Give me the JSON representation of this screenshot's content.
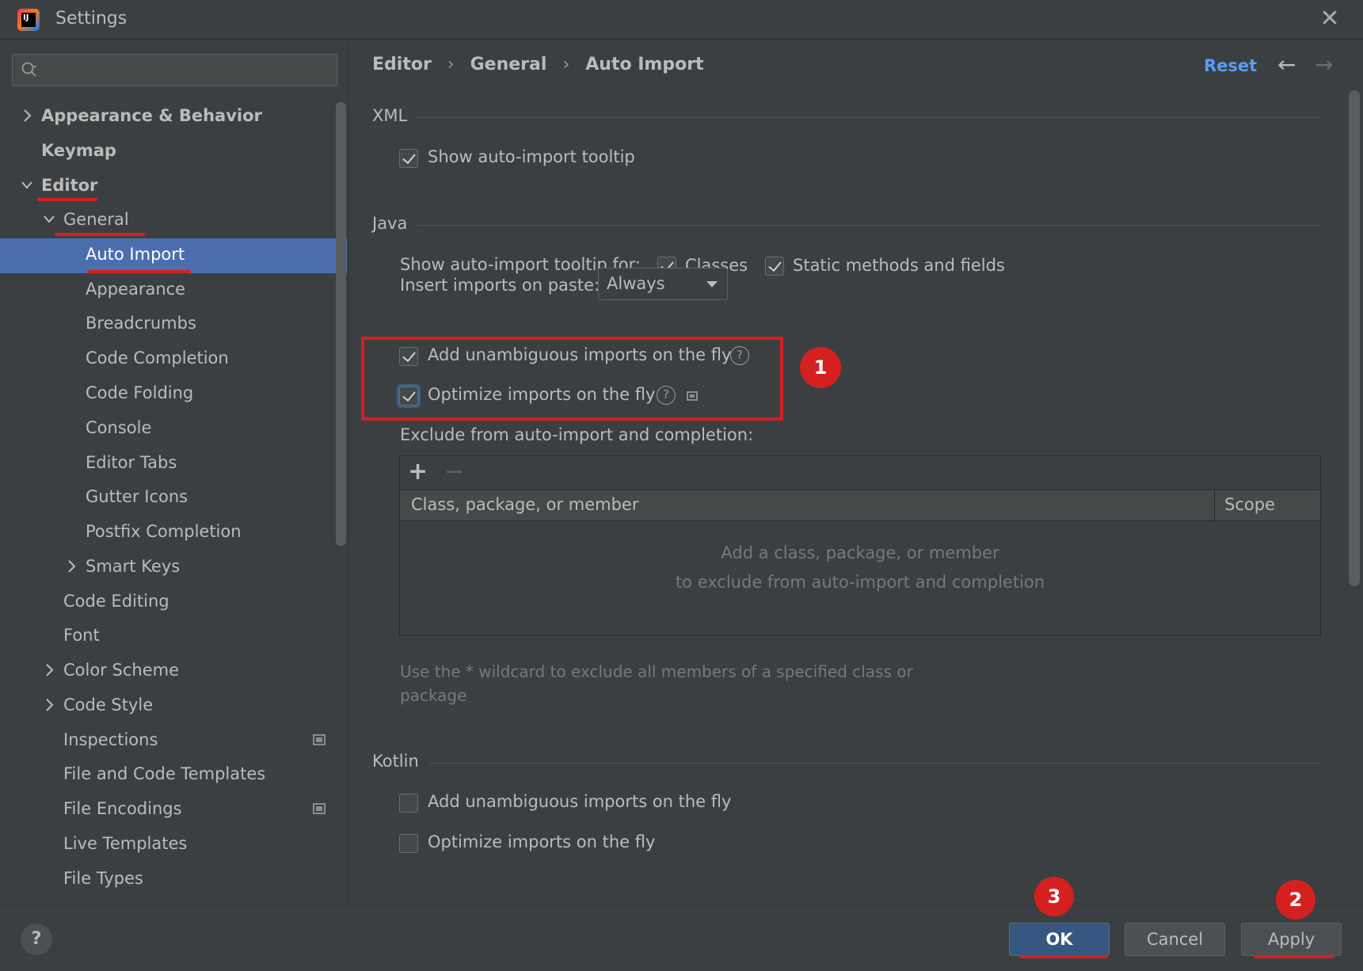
{
  "window": {
    "title": "Settings",
    "logo_text": "IJ"
  },
  "sidebar": {
    "search": {
      "placeholder": ""
    },
    "items": [
      {
        "label": "Appearance & Behavior",
        "arrow": "right"
      },
      {
        "label": "Keymap",
        "arrow": "none"
      },
      {
        "label": "Editor",
        "arrow": "down"
      },
      {
        "label": "General",
        "arrow": "down"
      },
      {
        "label": "Auto Import",
        "arrow": "none",
        "selected": true
      },
      {
        "label": "Appearance",
        "arrow": "none"
      },
      {
        "label": "Breadcrumbs",
        "arrow": "none"
      },
      {
        "label": "Code Completion",
        "arrow": "none"
      },
      {
        "label": "Code Folding",
        "arrow": "none"
      },
      {
        "label": "Console",
        "arrow": "none"
      },
      {
        "label": "Editor Tabs",
        "arrow": "none"
      },
      {
        "label": "Gutter Icons",
        "arrow": "none"
      },
      {
        "label": "Postfix Completion",
        "arrow": "none"
      },
      {
        "label": "Smart Keys",
        "arrow": "right"
      },
      {
        "label": "Code Editing",
        "arrow": "none"
      },
      {
        "label": "Font",
        "arrow": "none"
      },
      {
        "label": "Color Scheme",
        "arrow": "right"
      },
      {
        "label": "Code Style",
        "arrow": "right"
      },
      {
        "label": "Inspections",
        "arrow": "none",
        "badge": "project-settings-icon"
      },
      {
        "label": "File and Code Templates",
        "arrow": "none"
      },
      {
        "label": "File Encodings",
        "arrow": "none",
        "badge": "project-settings-icon"
      },
      {
        "label": "Live Templates",
        "arrow": "none"
      },
      {
        "label": "File Types",
        "arrow": "none"
      }
    ]
  },
  "breadcrumb": {
    "items": [
      "Editor",
      "General",
      "Auto Import"
    ],
    "separator": "›",
    "reset_label": "Reset",
    "back_icon": "←",
    "forward_icon": "→"
  },
  "xml": {
    "title": "XML",
    "show_tooltip": {
      "label": "Show auto-import tooltip",
      "checked": true
    }
  },
  "java": {
    "title": "Java",
    "tooltip_for_label": "Show auto-import tooltip for:",
    "classes": {
      "label": "Classes",
      "checked": true
    },
    "static_members": {
      "label": "Static methods and fields",
      "checked": true
    },
    "insert_on_paste_label": "Insert imports on paste:",
    "insert_on_paste_value": "Always",
    "add_unambiguous": {
      "label": "Add unambiguous imports on the fly",
      "checked": true
    },
    "optimize": {
      "label": "Optimize imports on the fly",
      "checked": true
    },
    "exclude_label": "Exclude from auto-import and completion:",
    "table": {
      "add_icon": "+",
      "remove_icon": "−",
      "columns": [
        "Class, package, or member",
        "Scope"
      ],
      "empty_line1": "Add a class, package, or member",
      "empty_line2": "to exclude from auto-import and completion"
    },
    "hint": "Use the * wildcard to exclude all members of a specified class or package"
  },
  "kotlin": {
    "title": "Kotlin",
    "add_unambiguous": {
      "label": "Add unambiguous imports on the fly",
      "checked": false
    },
    "optimize": {
      "label": "Optimize imports on the fly",
      "checked": false
    }
  },
  "annotations": {
    "marker1": "1",
    "marker2": "2",
    "marker3": "3"
  },
  "footer": {
    "help_label": "?",
    "ok_label": "OK",
    "cancel_label": "Cancel",
    "apply_label": "Apply"
  },
  "colors": {
    "background": "#3c3f41",
    "selection": "#4b6eaf",
    "link": "#589df6",
    "annotation_red": "#d52020",
    "primary_button": "#365880"
  }
}
